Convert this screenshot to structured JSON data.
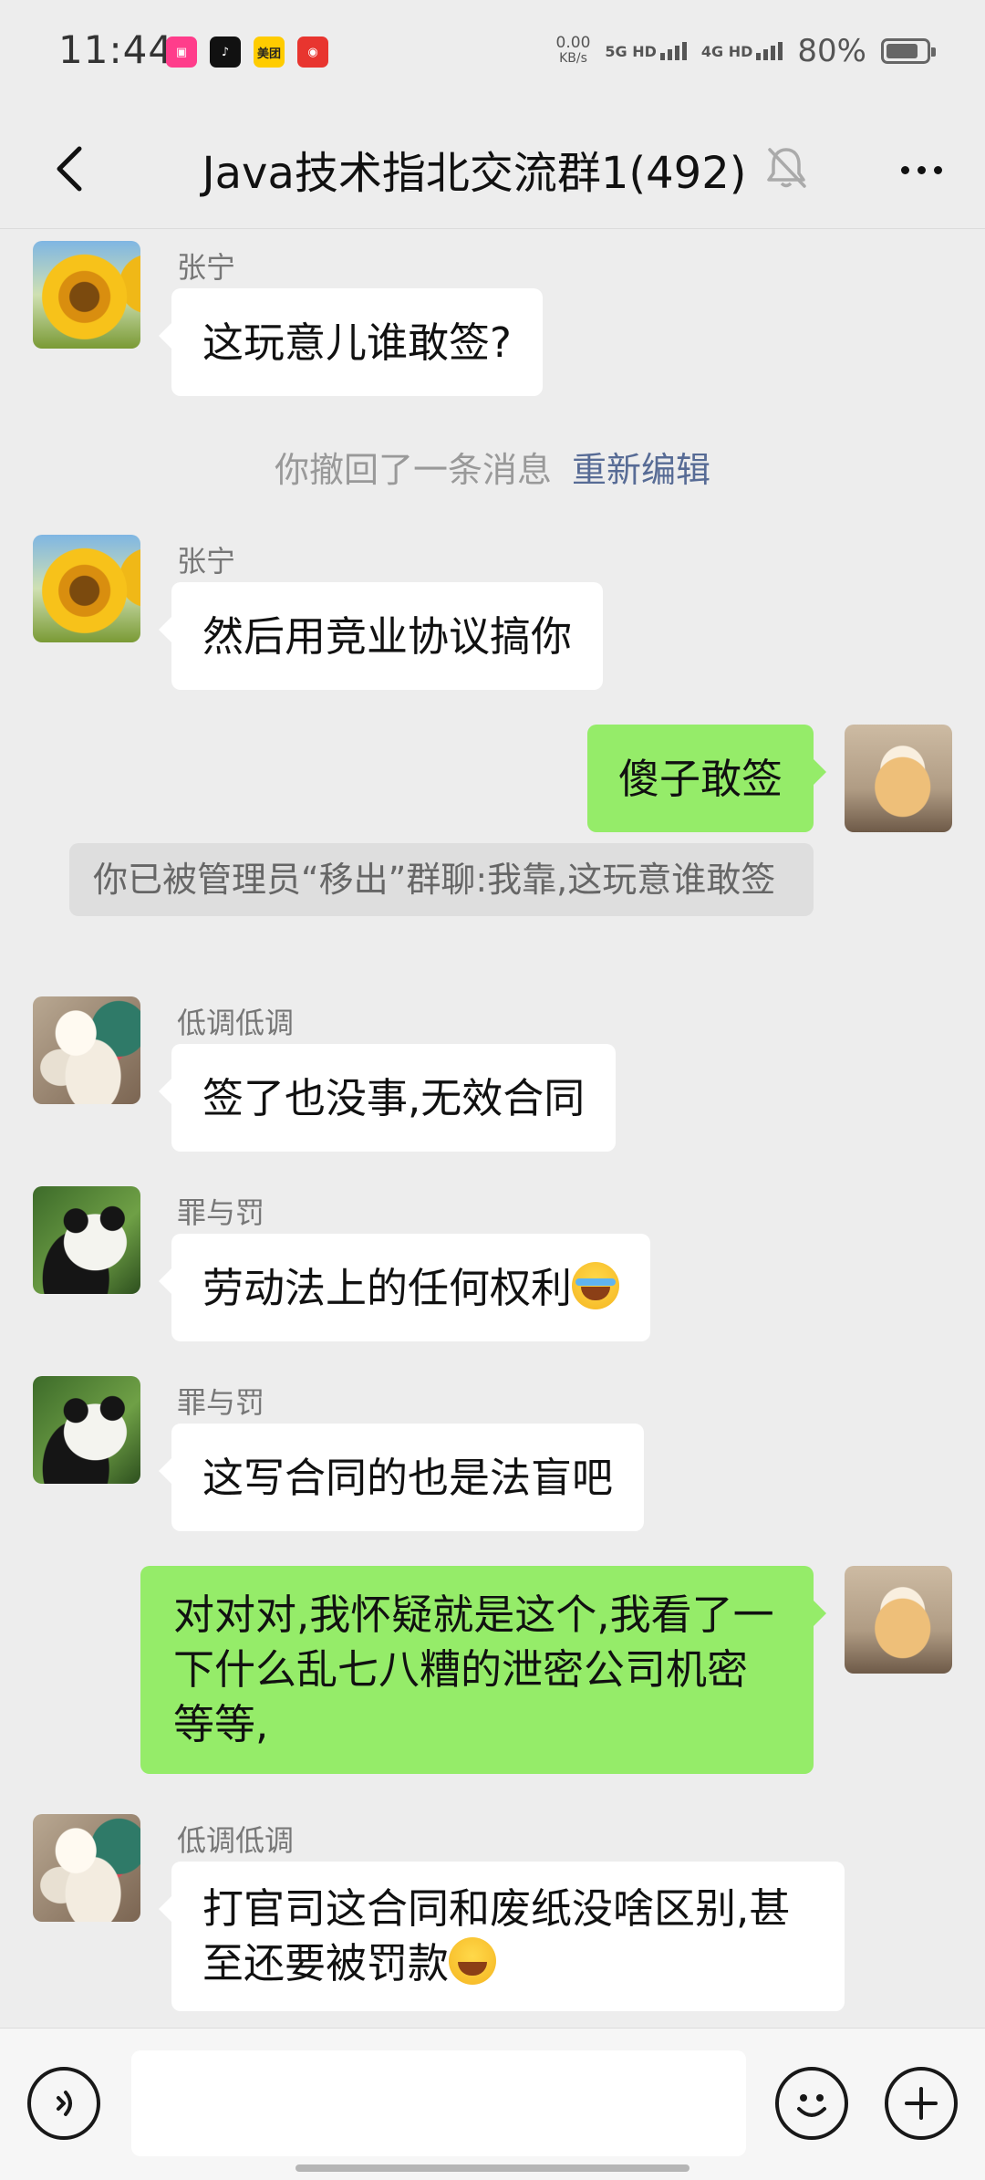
{
  "status_bar": {
    "time": "11:44",
    "net_speed": "0.00",
    "net_speed_unit": "KB/s",
    "net1": "5G HD",
    "net2": "4G HD",
    "battery": "80%",
    "battery_level": 0.8,
    "app_icons": [
      {
        "name": "pink-app-icon",
        "color": "#ff3d8b"
      },
      {
        "name": "tiktok-icon",
        "color": "#111111"
      },
      {
        "name": "meituan-icon",
        "color": "#ffcc00",
        "label": "美团"
      },
      {
        "name": "red-app-icon",
        "color": "#e8352f"
      }
    ]
  },
  "header": {
    "title": "Java技术指北交流群1(492)"
  },
  "messages": [
    {
      "sender": "张宁",
      "text": "这玩意儿谁敢签?"
    },
    {
      "system": "你撤回了一条消息",
      "action": "重新编辑"
    },
    {
      "sender": "张宁",
      "text": "然后用竞业协议搞你"
    },
    {
      "text": "傻子敢签"
    },
    {
      "notice": "你已被管理员“移出”群聊:我靠,这玩意谁敢签"
    },
    {
      "sender": "低调低调",
      "text": "签了也没事,无效合同"
    },
    {
      "sender": "罪与罚",
      "text": "劳动法上的任何权利"
    },
    {
      "sender": "罪与罚",
      "text": "这写合同的也是法盲吧"
    },
    {
      "text": "对对对,我怀疑就是这个,我看了一下什么乱七八糟的泄密公司机密等等,"
    },
    {
      "sender": "低调低调",
      "text": "打官司这合同和废纸没啥区别,甚至还要被罚款"
    }
  ],
  "colors": {
    "background": "#ededed",
    "self_bubble": "#95ec69",
    "other_bubble": "#ffffff",
    "link": "#576b95"
  }
}
